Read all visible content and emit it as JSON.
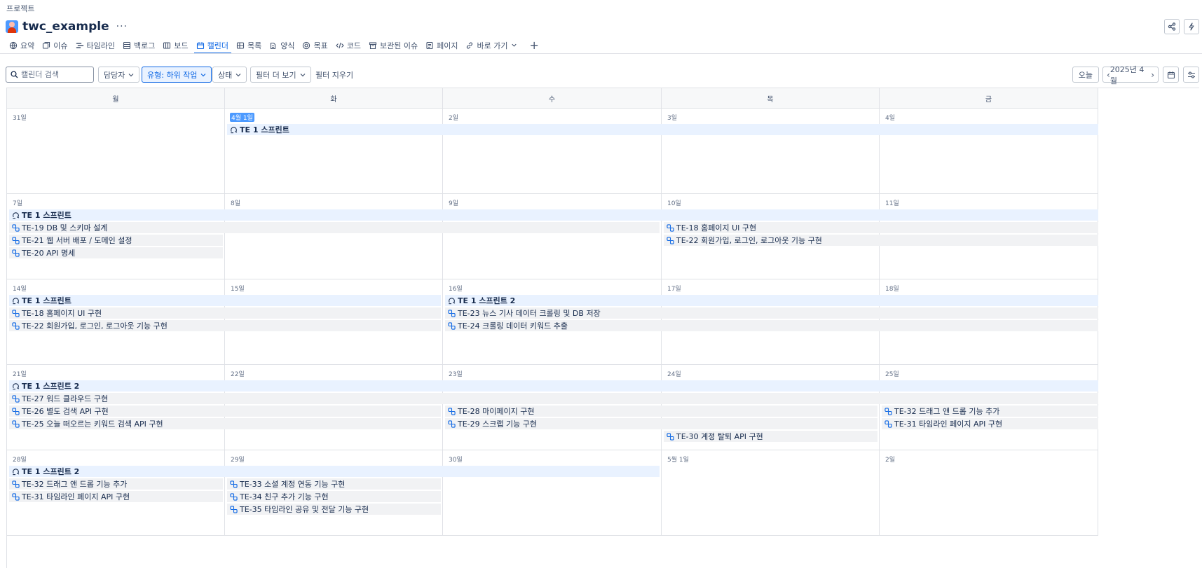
{
  "breadcrumb": "프로젝트",
  "project": {
    "title": "twc_example",
    "more": "···"
  },
  "tabs": [
    {
      "label": "요약",
      "icon": "globe-icon"
    },
    {
      "label": "이슈",
      "icon": "issues-icon"
    },
    {
      "label": "타임라인",
      "icon": "timeline-icon"
    },
    {
      "label": "백로그",
      "icon": "backlog-icon"
    },
    {
      "label": "보드",
      "icon": "board-icon"
    },
    {
      "label": "캘린더",
      "icon": "calendar-icon",
      "active": true
    },
    {
      "label": "목록",
      "icon": "list-icon"
    },
    {
      "label": "양식",
      "icon": "forms-icon"
    },
    {
      "label": "목표",
      "icon": "goal-icon"
    },
    {
      "label": "코드",
      "icon": "code-icon"
    },
    {
      "label": "보관된 이슈",
      "icon": "archive-icon"
    },
    {
      "label": "페이지",
      "icon": "page-icon"
    },
    {
      "label": "바로 가기",
      "icon": "link-icon"
    }
  ],
  "tab_add": "+",
  "toolbar": {
    "search_placeholder": "캘린더 검색",
    "assignee": "담당자",
    "type": "유형: 하위 작업",
    "status": "상태",
    "more_filters": "필터 더 보기",
    "clear_filters": "필터 지우기",
    "today": "오늘",
    "month": "2025년 4월"
  },
  "weekdays": [
    "월",
    "화",
    "수",
    "목",
    "금"
  ],
  "weeks": [
    {
      "days": [
        "31일",
        "4월 1일",
        "2일",
        "3일",
        "4일"
      ],
      "today_index": 1,
      "events": [
        {
          "kind": "sprint",
          "label": "TE 1 스프린트",
          "start": 1,
          "end": 4,
          "lane": 0
        }
      ]
    },
    {
      "days": [
        "7일",
        "8일",
        "9일",
        "10일",
        "11일"
      ],
      "events": [
        {
          "kind": "sprint",
          "label": "TE 1 스프린트",
          "start": 0,
          "end": 4,
          "lane": 0
        },
        {
          "kind": "issue",
          "label": "TE-19 DB 및 스키마 설계",
          "start": 0,
          "end": 2,
          "lane": 1
        },
        {
          "kind": "issue",
          "label": "TE-18 홈페이지 UI 구현",
          "start": 3,
          "end": 4,
          "lane": 1
        },
        {
          "kind": "issue",
          "label": "TE-21 웹 서버 배포 / 도메인 설정",
          "start": 0,
          "end": 0,
          "lane": 2
        },
        {
          "kind": "issue",
          "label": "TE-22 회원가입, 로그인, 로그아웃 기능 구현",
          "start": 3,
          "end": 4,
          "lane": 2
        },
        {
          "kind": "issue",
          "label": "TE-20 API 명세",
          "start": 0,
          "end": 0,
          "lane": 3
        }
      ]
    },
    {
      "days": [
        "14일",
        "15일",
        "16일",
        "17일",
        "18일"
      ],
      "events": [
        {
          "kind": "sprint",
          "label": "TE 1 스프린트",
          "start": 0,
          "end": 1,
          "lane": 0
        },
        {
          "kind": "sprint",
          "label": "TE 1 스프린트 2",
          "start": 2,
          "end": 4,
          "lane": 0
        },
        {
          "kind": "issue",
          "label": "TE-18 홈페이지 UI 구현",
          "start": 0,
          "end": 1,
          "lane": 1
        },
        {
          "kind": "issue",
          "label": "TE-23 뉴스 기사 데이터 크롤링 및 DB 저장",
          "start": 2,
          "end": 4,
          "lane": 1
        },
        {
          "kind": "issue",
          "label": "TE-22 회원가입, 로그인, 로그아웃 기능 구현",
          "start": 0,
          "end": 1,
          "lane": 2
        },
        {
          "kind": "issue",
          "label": "TE-24 크롤링 데이터 키워드 추출",
          "start": 2,
          "end": 4,
          "lane": 2
        }
      ]
    },
    {
      "days": [
        "21일",
        "22일",
        "23일",
        "24일",
        "25일"
      ],
      "events": [
        {
          "kind": "sprint",
          "label": "TE 1 스프린트 2",
          "start": 0,
          "end": 4,
          "lane": 0
        },
        {
          "kind": "issue",
          "label": "TE-27 워드 클라우드 구현",
          "start": 0,
          "end": 4,
          "lane": 1
        },
        {
          "kind": "issue",
          "label": "TE-26 별도 검색 API 구현",
          "start": 0,
          "end": 1,
          "lane": 2
        },
        {
          "kind": "issue",
          "label": "TE-28 마이페이지 구현",
          "start": 2,
          "end": 3,
          "lane": 2
        },
        {
          "kind": "issue",
          "label": "TE-32 드래그 앤 드롭 기능 추가",
          "start": 4,
          "end": 4,
          "lane": 2
        },
        {
          "kind": "issue",
          "label": "TE-25 오늘 떠오르는 키워드 검색 API 구현",
          "start": 0,
          "end": 1,
          "lane": 3
        },
        {
          "kind": "issue",
          "label": "TE-29 스크랩 기능 구현",
          "start": 2,
          "end": 3,
          "lane": 3
        },
        {
          "kind": "issue",
          "label": "TE-31 타임라인 페이지 API 구현",
          "start": 4,
          "end": 4,
          "lane": 3
        },
        {
          "kind": "issue",
          "label": "TE-30 계정 탈퇴 API 구현",
          "start": 3,
          "end": 3,
          "lane": 4
        }
      ]
    },
    {
      "days": [
        "28일",
        "29일",
        "30일",
        "5월 1일",
        "2일"
      ],
      "events": [
        {
          "kind": "sprint",
          "label": "TE 1 스프린트 2",
          "start": 0,
          "end": 2,
          "lane": 0
        },
        {
          "kind": "issue",
          "label": "TE-32 드래그 앤 드롭 기능 추가",
          "start": 0,
          "end": 0,
          "lane": 1
        },
        {
          "kind": "issue",
          "label": "TE-33 소셜 계정 연동 기능 구현",
          "start": 1,
          "end": 1,
          "lane": 1
        },
        {
          "kind": "issue",
          "label": "TE-31 타임라인 페이지 API 구현",
          "start": 0,
          "end": 0,
          "lane": 2
        },
        {
          "kind": "issue",
          "label": "TE-34 친구 추가 기능 구현",
          "start": 1,
          "end": 1,
          "lane": 2
        },
        {
          "kind": "issue",
          "label": "TE-35 타임라인 공유 및 전달 기능 구현",
          "start": 1,
          "end": 1,
          "lane": 3
        }
      ]
    }
  ],
  "colors": {
    "accent": "#0c66e4",
    "sprint_bg": "#e9f2ff",
    "issue_bg": "#f1f2f4",
    "today_badge": "#4c9aff"
  }
}
